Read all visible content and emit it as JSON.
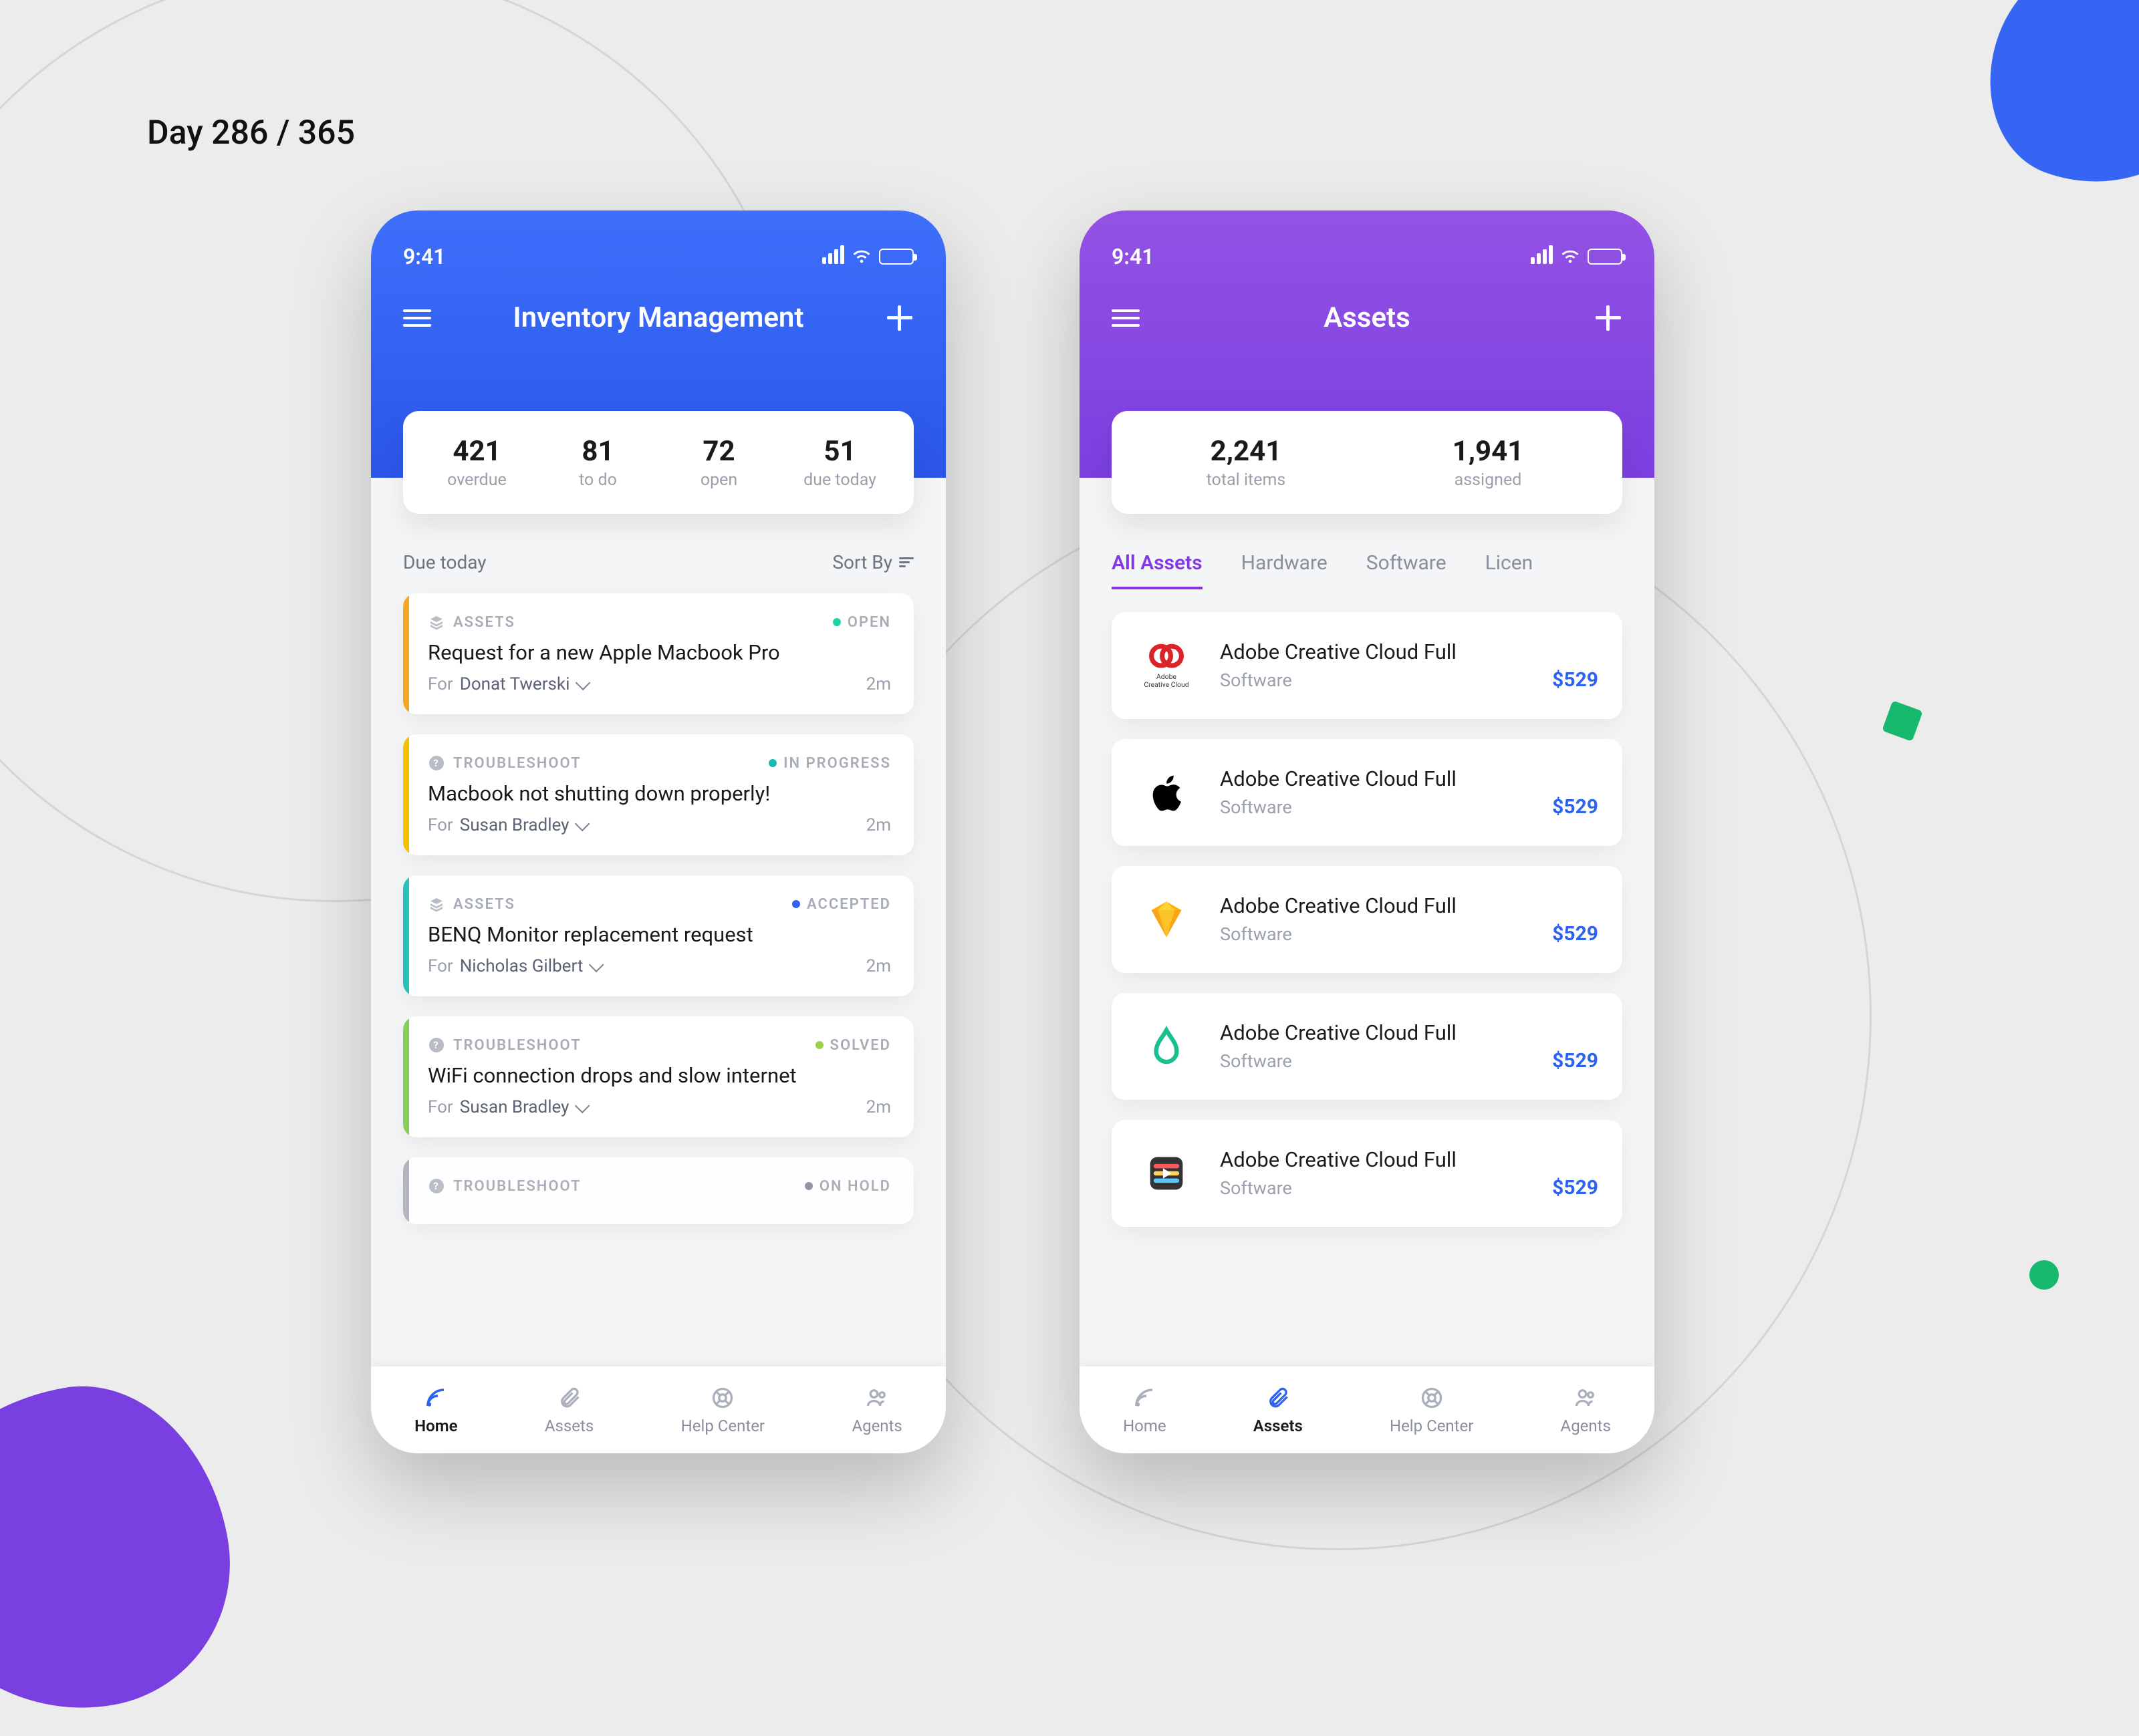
{
  "page_label": "Day 286 / 365",
  "status_time": "9:41",
  "screens": {
    "inventory": {
      "title": "Inventory Management",
      "stats": [
        {
          "value": "421",
          "label": "overdue"
        },
        {
          "value": "81",
          "label": "to do"
        },
        {
          "value": "72",
          "label": "open"
        },
        {
          "value": "51",
          "label": "due today"
        }
      ],
      "section_label": "Due today",
      "sort_label": "Sort By",
      "for_label": "For",
      "tickets": [
        {
          "bar": "orange",
          "cat": "ASSETS",
          "cat_icon": "layers",
          "status": "OPEN",
          "dot": "dot-open",
          "title": "Request for a new Apple Macbook Pro",
          "assignee": "Donat Twerski",
          "time": "2m"
        },
        {
          "bar": "yellow",
          "cat": "TROUBLESHOOT",
          "cat_icon": "question",
          "status": "IN PROGRESS",
          "dot": "dot-progress",
          "title": "Macbook not shutting down properly!",
          "assignee": "Susan Bradley",
          "time": "2m"
        },
        {
          "bar": "teal",
          "cat": "ASSETS",
          "cat_icon": "layers",
          "status": "ACCEPTED",
          "dot": "dot-accepted",
          "title": "BENQ Monitor replacement request",
          "assignee": "Nicholas Gilbert",
          "time": "2m"
        },
        {
          "bar": "green",
          "cat": "TROUBLESHOOT",
          "cat_icon": "question",
          "status": "SOLVED",
          "dot": "dot-solved",
          "title": "WiFi connection drops and slow internet",
          "assignee": "Susan Bradley",
          "time": "2m"
        },
        {
          "bar": "gray",
          "cat": "TROUBLESHOOT",
          "cat_icon": "question",
          "status": "ON HOLD",
          "dot": "dot-hold",
          "title": "",
          "assignee": "",
          "time": ""
        }
      ]
    },
    "assets": {
      "title": "Assets",
      "stats": [
        {
          "value": "2,241",
          "label": "total items"
        },
        {
          "value": "1,941",
          "label": "assigned"
        }
      ],
      "tabs": [
        "All Assets",
        "Hardware",
        "Software",
        "Licen"
      ],
      "active_tab": 0,
      "items": [
        {
          "icon": "adobe-cc",
          "title": "Adobe Creative Cloud Full",
          "sub": "Software",
          "price": "$529"
        },
        {
          "icon": "apple",
          "title": "Adobe Creative Cloud Full",
          "sub": "Software",
          "price": "$529"
        },
        {
          "icon": "sketch",
          "title": "Adobe Creative Cloud Full",
          "sub": "Software",
          "price": "$529"
        },
        {
          "icon": "avocado",
          "title": "Adobe Creative Cloud Full",
          "sub": "Software",
          "price": "$529"
        },
        {
          "icon": "fcpx",
          "title": "Adobe Creative Cloud Full",
          "sub": "Software",
          "price": "$529"
        }
      ]
    }
  },
  "tab_bar": {
    "items": [
      {
        "icon": "feed",
        "label": "Home"
      },
      {
        "icon": "clip",
        "label": "Assets"
      },
      {
        "icon": "help",
        "label": "Help Center"
      },
      {
        "icon": "agents",
        "label": "Agents"
      }
    ],
    "inventory_active": 0,
    "assets_active": 1
  }
}
